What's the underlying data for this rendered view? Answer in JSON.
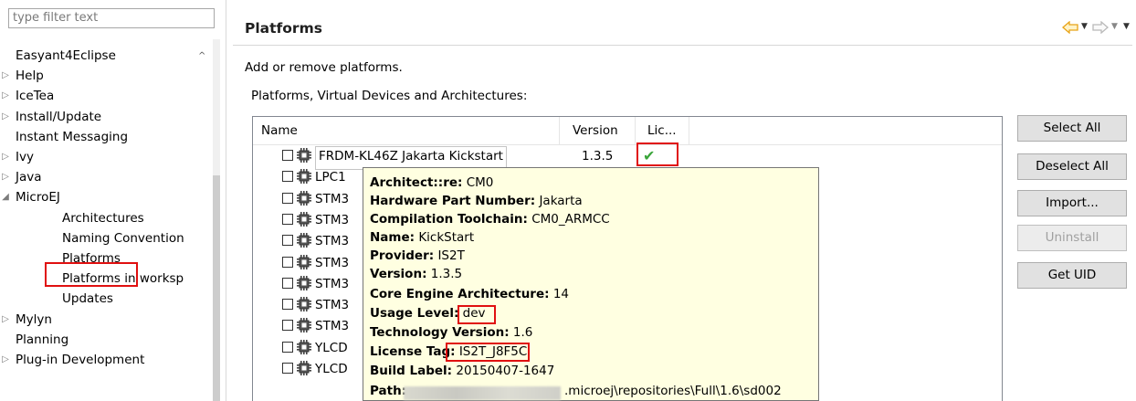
{
  "filter": {
    "placeholder": "type filter text"
  },
  "tree": {
    "items": [
      {
        "label": "Easyant4Eclipse",
        "twisty": ""
      },
      {
        "label": "Help",
        "twisty": "▷"
      },
      {
        "label": "IceTea",
        "twisty": "▷"
      },
      {
        "label": "Install/Update",
        "twisty": "▷"
      },
      {
        "label": "Instant Messaging",
        "twisty": ""
      },
      {
        "label": "Ivy",
        "twisty": "▷"
      },
      {
        "label": "Java",
        "twisty": "▷"
      },
      {
        "label": "MicroEJ",
        "twisty": "◢"
      },
      {
        "label": "Architectures",
        "twisty": ""
      },
      {
        "label": "Naming Convention",
        "twisty": ""
      },
      {
        "label": "Platforms",
        "twisty": ""
      },
      {
        "label": "Platforms in worksp",
        "twisty": ""
      },
      {
        "label": "Updates",
        "twisty": ""
      },
      {
        "label": "Mylyn",
        "twisty": "▷"
      },
      {
        "label": "Planning",
        "twisty": ""
      },
      {
        "label": "Plug-in Development",
        "twisty": "▷"
      }
    ]
  },
  "header": {
    "title": "Platforms"
  },
  "description": "Add or remove platforms.",
  "list_label": "Platforms, Virtual Devices and Architectures:",
  "table": {
    "columns": [
      "Name",
      "Version",
      "Lic..."
    ],
    "rows": [
      {
        "name": "FRDM-KL46Z Jakarta Kickstart",
        "version": "1.3.5",
        "license": "✔"
      },
      {
        "name": "LPC1",
        "version": "",
        "license": ""
      },
      {
        "name": "STM3",
        "version": "",
        "license": ""
      },
      {
        "name": "STM3",
        "version": "",
        "license": ""
      },
      {
        "name": "STM3",
        "version": "",
        "license": ""
      },
      {
        "name": "STM3",
        "version": "",
        "license": ""
      },
      {
        "name": "STM3",
        "version": "",
        "license": ""
      },
      {
        "name": "STM3",
        "version": "",
        "license": ""
      },
      {
        "name": "STM3",
        "version": "",
        "license": ""
      },
      {
        "name": "YLCD",
        "version": "",
        "license": ""
      },
      {
        "name": "YLCD",
        "version": "",
        "license": ""
      }
    ]
  },
  "buttons": {
    "select_all": "Select All",
    "deselect_all": "Deselect All",
    "import": "Import...",
    "uninstall": "Uninstall",
    "get_uid": "Get UID"
  },
  "tooltip": {
    "architecture_label": "Architect::re:",
    "architecture": "CM0",
    "hw_label": "Hardware Part Number:",
    "hw": "Jakarta",
    "toolchain_label": "Compilation Toolchain:",
    "toolchain": "CM0_ARMCC",
    "name_label": "Name:",
    "name": "KickStart",
    "provider_label": "Provider:",
    "provider": "IS2T",
    "version_label": "Version:",
    "version": "1.3.5",
    "core_label": "Core Engine Architecture:",
    "core": "14",
    "usage_label": "Usage Level:",
    "usage": "dev",
    "tech_label": "Technology Version:",
    "tech": "1.6",
    "license_label": "License Tag:",
    "license": "IS2T_J8F5C",
    "build_label": "Build Label:",
    "build": "20150407-1647",
    "path_label": "Path:",
    "path": ".microej\\repositories\\Full\\1.6\\sd002"
  },
  "colors": {
    "tooltip_bg": "#ffffe1",
    "highlight": "#e01010",
    "check": "#3aa53a",
    "nav_arrow": "#e8a317"
  },
  "icons": {
    "back": "back-arrow-icon",
    "forward": "forward-arrow-icon",
    "menu": "view-menu-icon",
    "chip": "chip-icon",
    "check": "checkmark-icon"
  }
}
